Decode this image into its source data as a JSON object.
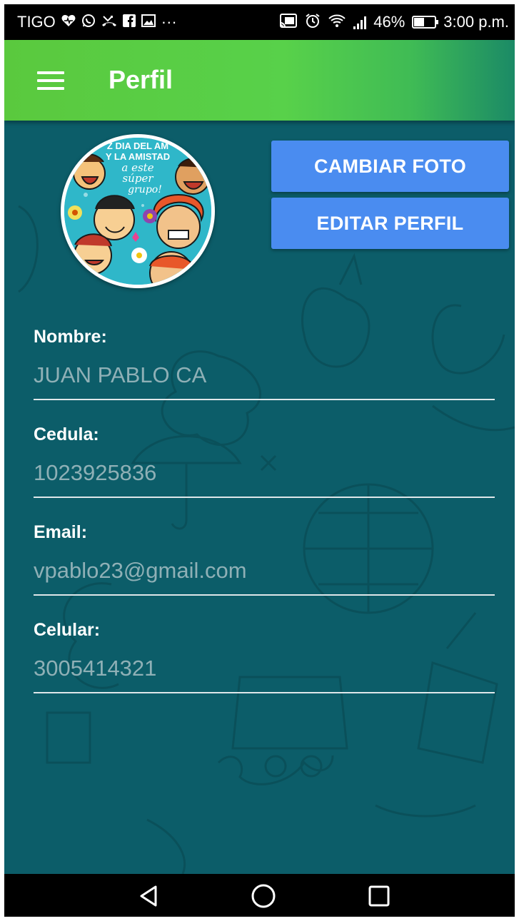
{
  "status_bar": {
    "carrier": "TIGO",
    "notification_icons": [
      "heart-icon",
      "whatsapp-icon",
      "missed-call-icon",
      "facebook-icon",
      "gallery-icon"
    ],
    "more_indicator": "···",
    "battery_percent": "46%",
    "battery_level": 0.46,
    "time": "3:00 p.m."
  },
  "app_bar": {
    "title": "Perfil",
    "color_start": "#5ac93e",
    "color_end": "#1b8a66"
  },
  "profile": {
    "change_photo_label": "CAMBIAR FOTO",
    "edit_profile_label": "EDITAR PERFIL",
    "avatar_text_lines": [
      "Z DIA DEL AM",
      "Y LA AMISTAD",
      "a este",
      "súper",
      "grupo!"
    ],
    "fields": [
      {
        "label": "Nombre:",
        "value": "JUAN PABLO CA"
      },
      {
        "label": "Cedula:",
        "value": "1023925836"
      },
      {
        "label": "Email:",
        "value": "vpablo23@gmail.com"
      },
      {
        "label": "Celular:",
        "value": "3005414321"
      }
    ]
  },
  "colors": {
    "background": "#0c5d69",
    "button": "#4a8cf0",
    "field_text": "#8fb0b6"
  },
  "nav_bar": {
    "icons": [
      "back-icon",
      "home-icon",
      "recents-icon"
    ]
  }
}
